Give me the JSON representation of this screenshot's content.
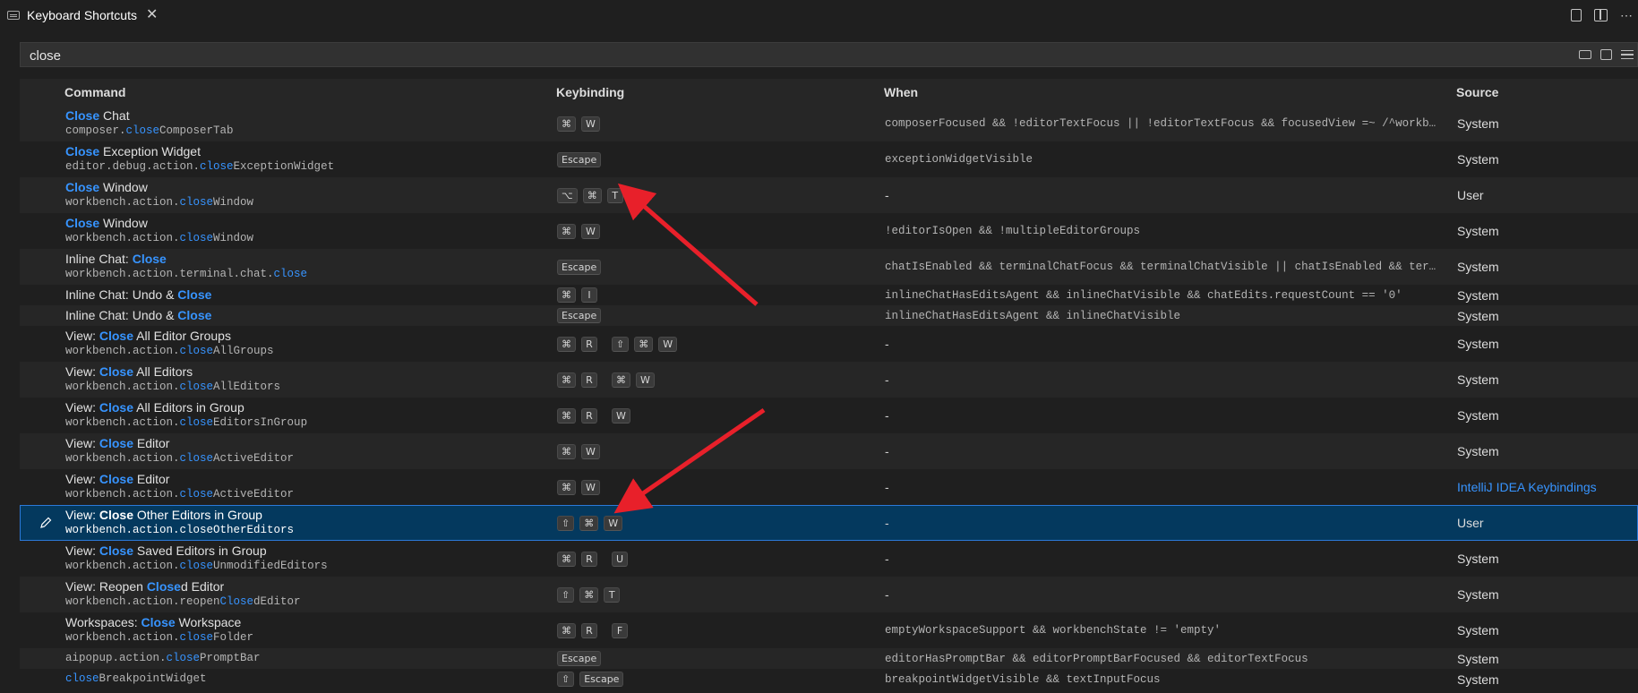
{
  "tab": {
    "title": "Keyboard Shortcuts",
    "close": "✕"
  },
  "search": {
    "value": "close"
  },
  "headers": {
    "command": "Command",
    "keybinding": "Keybinding",
    "when": "When",
    "source": "Source"
  },
  "rows": [
    {
      "label": [
        [
          "Close",
          true
        ],
        [
          " Chat",
          false
        ]
      ],
      "id": [
        [
          "composer.",
          false
        ],
        [
          "close",
          true
        ],
        [
          "ComposerTab",
          false
        ]
      ],
      "keys": [
        [
          "⌘",
          "W"
        ]
      ],
      "when": "composerFocused && !editorTextFocus || !editorTextFocus && focusedView =~ /^workbench.pa...",
      "source": "System"
    },
    {
      "label": [
        [
          "Close",
          true
        ],
        [
          " Exception Widget",
          false
        ]
      ],
      "id": [
        [
          "editor.debug.action.",
          false
        ],
        [
          "close",
          true
        ],
        [
          "ExceptionWidget",
          false
        ]
      ],
      "keys": [
        [
          "Escape"
        ]
      ],
      "when": "exceptionWidgetVisible",
      "source": "System"
    },
    {
      "label": [
        [
          "Close",
          true
        ],
        [
          " Window",
          false
        ]
      ],
      "id": [
        [
          "workbench.action.",
          false
        ],
        [
          "close",
          true
        ],
        [
          "Window",
          false
        ]
      ],
      "keys": [
        [
          "⌥",
          "⌘",
          "T"
        ]
      ],
      "when": "-",
      "source": "User"
    },
    {
      "label": [
        [
          "Close",
          true
        ],
        [
          " Window",
          false
        ]
      ],
      "id": [
        [
          "workbench.action.",
          false
        ],
        [
          "close",
          true
        ],
        [
          "Window",
          false
        ]
      ],
      "keys": [
        [
          "⌘",
          "W"
        ]
      ],
      "when": "!editorIsOpen && !multipleEditorGroups",
      "source": "System"
    },
    {
      "label": [
        [
          "Inline Chat: ",
          false
        ],
        [
          "Close",
          true
        ]
      ],
      "id": [
        [
          "workbench.action.terminal.chat.",
          false
        ],
        [
          "close",
          true
        ]
      ],
      "keys": [
        [
          "Escape"
        ]
      ],
      "when": "chatIsEnabled && terminalChatFocus && terminalChatVisible || chatIsEnabled && terminalCh...",
      "source": "System"
    },
    {
      "label": [
        [
          "Inline Chat: Undo & ",
          false
        ],
        [
          "Close",
          true
        ]
      ],
      "id": null,
      "keys": [
        [
          "⌘",
          "I"
        ]
      ],
      "when": "inlineChatHasEditsAgent && inlineChatVisible && chatEdits.requestCount == '0'",
      "source": "System"
    },
    {
      "label": [
        [
          "Inline Chat: Undo & ",
          false
        ],
        [
          "Close",
          true
        ]
      ],
      "id": null,
      "keys": [
        [
          "Escape"
        ]
      ],
      "when": "inlineChatHasEditsAgent && inlineChatVisible",
      "source": "System"
    },
    {
      "label": [
        [
          "View: ",
          false
        ],
        [
          "Close",
          true
        ],
        [
          " All Editor Groups",
          false
        ]
      ],
      "id": [
        [
          "workbench.action.",
          false
        ],
        [
          "close",
          true
        ],
        [
          "AllGroups",
          false
        ]
      ],
      "keys": [
        [
          "⌘",
          "R"
        ],
        [
          "⇧",
          "⌘",
          "W"
        ]
      ],
      "when": "-",
      "source": "System"
    },
    {
      "label": [
        [
          "View: ",
          false
        ],
        [
          "Close",
          true
        ],
        [
          " All Editors",
          false
        ]
      ],
      "id": [
        [
          "workbench.action.",
          false
        ],
        [
          "close",
          true
        ],
        [
          "AllEditors",
          false
        ]
      ],
      "keys": [
        [
          "⌘",
          "R"
        ],
        [
          "⌘",
          "W"
        ]
      ],
      "when": "-",
      "source": "System"
    },
    {
      "label": [
        [
          "View: ",
          false
        ],
        [
          "Close",
          true
        ],
        [
          " All Editors in Group",
          false
        ]
      ],
      "id": [
        [
          "workbench.action.",
          false
        ],
        [
          "close",
          true
        ],
        [
          "EditorsInGroup",
          false
        ]
      ],
      "keys": [
        [
          "⌘",
          "R"
        ],
        [
          "W"
        ]
      ],
      "when": "-",
      "source": "System"
    },
    {
      "label": [
        [
          "View: ",
          false
        ],
        [
          "Close",
          true
        ],
        [
          " Editor",
          false
        ]
      ],
      "id": [
        [
          "workbench.action.",
          false
        ],
        [
          "close",
          true
        ],
        [
          "ActiveEditor",
          false
        ]
      ],
      "keys": [
        [
          "⌘",
          "W"
        ]
      ],
      "when": "-",
      "source": "System"
    },
    {
      "label": [
        [
          "View: ",
          false
        ],
        [
          "Close",
          true
        ],
        [
          " Editor",
          false
        ]
      ],
      "id": [
        [
          "workbench.action.",
          false
        ],
        [
          "close",
          true
        ],
        [
          "ActiveEditor",
          false
        ]
      ],
      "keys": [
        [
          "⌘",
          "W"
        ]
      ],
      "when": "-",
      "source": "IntelliJ IDEA Keybindings",
      "source_link": true
    },
    {
      "label": [
        [
          "View: ",
          false
        ],
        [
          "Close",
          true
        ],
        [
          " Other Editors in Group",
          false
        ]
      ],
      "id": [
        [
          "workbench.action.closeOtherEditors",
          false
        ]
      ],
      "keys": [
        [
          "⇧",
          "⌘",
          "W"
        ]
      ],
      "when": "-",
      "source": "User",
      "selected": true
    },
    {
      "label": [
        [
          "View: ",
          false
        ],
        [
          "Close",
          true
        ],
        [
          " Saved Editors in Group",
          false
        ]
      ],
      "id": [
        [
          "workbench.action.",
          false
        ],
        [
          "close",
          true
        ],
        [
          "UnmodifiedEditors",
          false
        ]
      ],
      "keys": [
        [
          "⌘",
          "R"
        ],
        [
          "U"
        ]
      ],
      "when": "-",
      "source": "System"
    },
    {
      "label": [
        [
          "View: Reopen ",
          false
        ],
        [
          "Close",
          true
        ],
        [
          "d Editor",
          false
        ]
      ],
      "id": [
        [
          "workbench.action.reopen",
          false
        ],
        [
          "Close",
          true
        ],
        [
          "dEditor",
          false
        ]
      ],
      "keys": [
        [
          "⇧",
          "⌘",
          "T"
        ]
      ],
      "when": "-",
      "source": "System"
    },
    {
      "label": [
        [
          "Workspaces: ",
          false
        ],
        [
          "Close",
          true
        ],
        [
          " Workspace",
          false
        ]
      ],
      "id": [
        [
          "workbench.action.",
          false
        ],
        [
          "close",
          true
        ],
        [
          "Folder",
          false
        ]
      ],
      "keys": [
        [
          "⌘",
          "R"
        ],
        [
          "F"
        ]
      ],
      "when": "emptyWorkspaceSupport && workbenchState != 'empty'",
      "source": "System"
    },
    {
      "label": null,
      "id": [
        [
          "aipopup.action.",
          false
        ],
        [
          "close",
          true
        ],
        [
          "PromptBar",
          false
        ]
      ],
      "keys": [
        [
          "Escape"
        ]
      ],
      "when": "editorHasPromptBar && editorPromptBarFocused && editorTextFocus",
      "source": "System"
    },
    {
      "label": null,
      "id": [
        [
          "close",
          true
        ],
        [
          "BreakpointWidget",
          false
        ]
      ],
      "keys": [
        [
          "⇧",
          "Escape"
        ]
      ],
      "when": "breakpointWidgetVisible && textInputFocus",
      "source": "System"
    }
  ],
  "colors": {
    "highlight": "#3794ff",
    "selected_bg": "#04395e",
    "annotation_arrow": "#e8202a"
  }
}
